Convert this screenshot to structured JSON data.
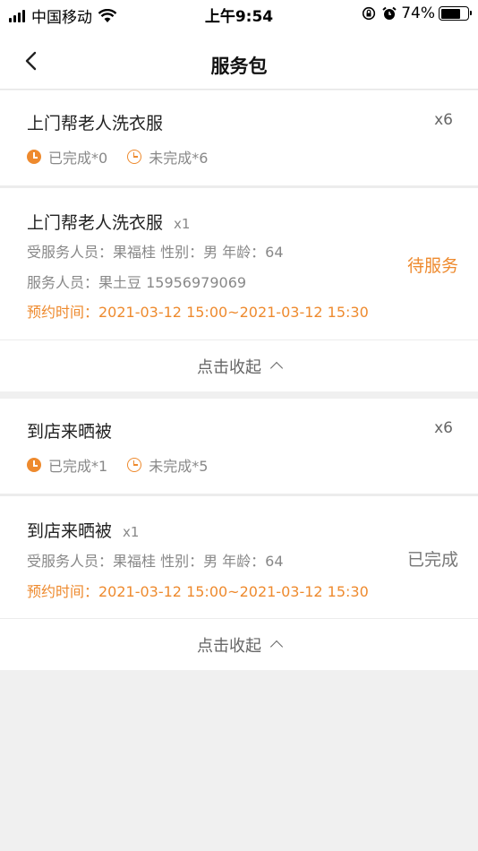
{
  "status_bar": {
    "carrier": "中国移动",
    "time": "上午9:54",
    "battery": "74%"
  },
  "header": {
    "title": "服务包"
  },
  "packages": [
    {
      "name": "上门帮老人洗衣服",
      "quantity": "x6",
      "completed": "已完成*0",
      "incomplete": "未完成*6",
      "detail": {
        "name": "上门帮老人洗衣服",
        "multiplier": "x1",
        "recipient": "受服务人员：果福桂 性别：男 年龄：64",
        "staff": "服务人员：果土豆 15956979069",
        "appointment": "预约时间：2021-03-12 15:00~2021-03-12 15:30",
        "status": "待服务"
      },
      "collapse_label": "点击收起"
    },
    {
      "name": "到店来晒被",
      "quantity": "x6",
      "completed": "已完成*1",
      "incomplete": "未完成*5",
      "detail": {
        "name": "到店来晒被",
        "multiplier": "x1",
        "recipient": "受服务人员：果福桂 性别：男 年龄：64",
        "appointment": "预约时间：2021-03-12 15:00~2021-03-12 15:30",
        "status": "已完成"
      },
      "collapse_label": "点击收起"
    }
  ],
  "colors": {
    "accent": "#ee8a2e",
    "background": "#f0f0f0"
  }
}
